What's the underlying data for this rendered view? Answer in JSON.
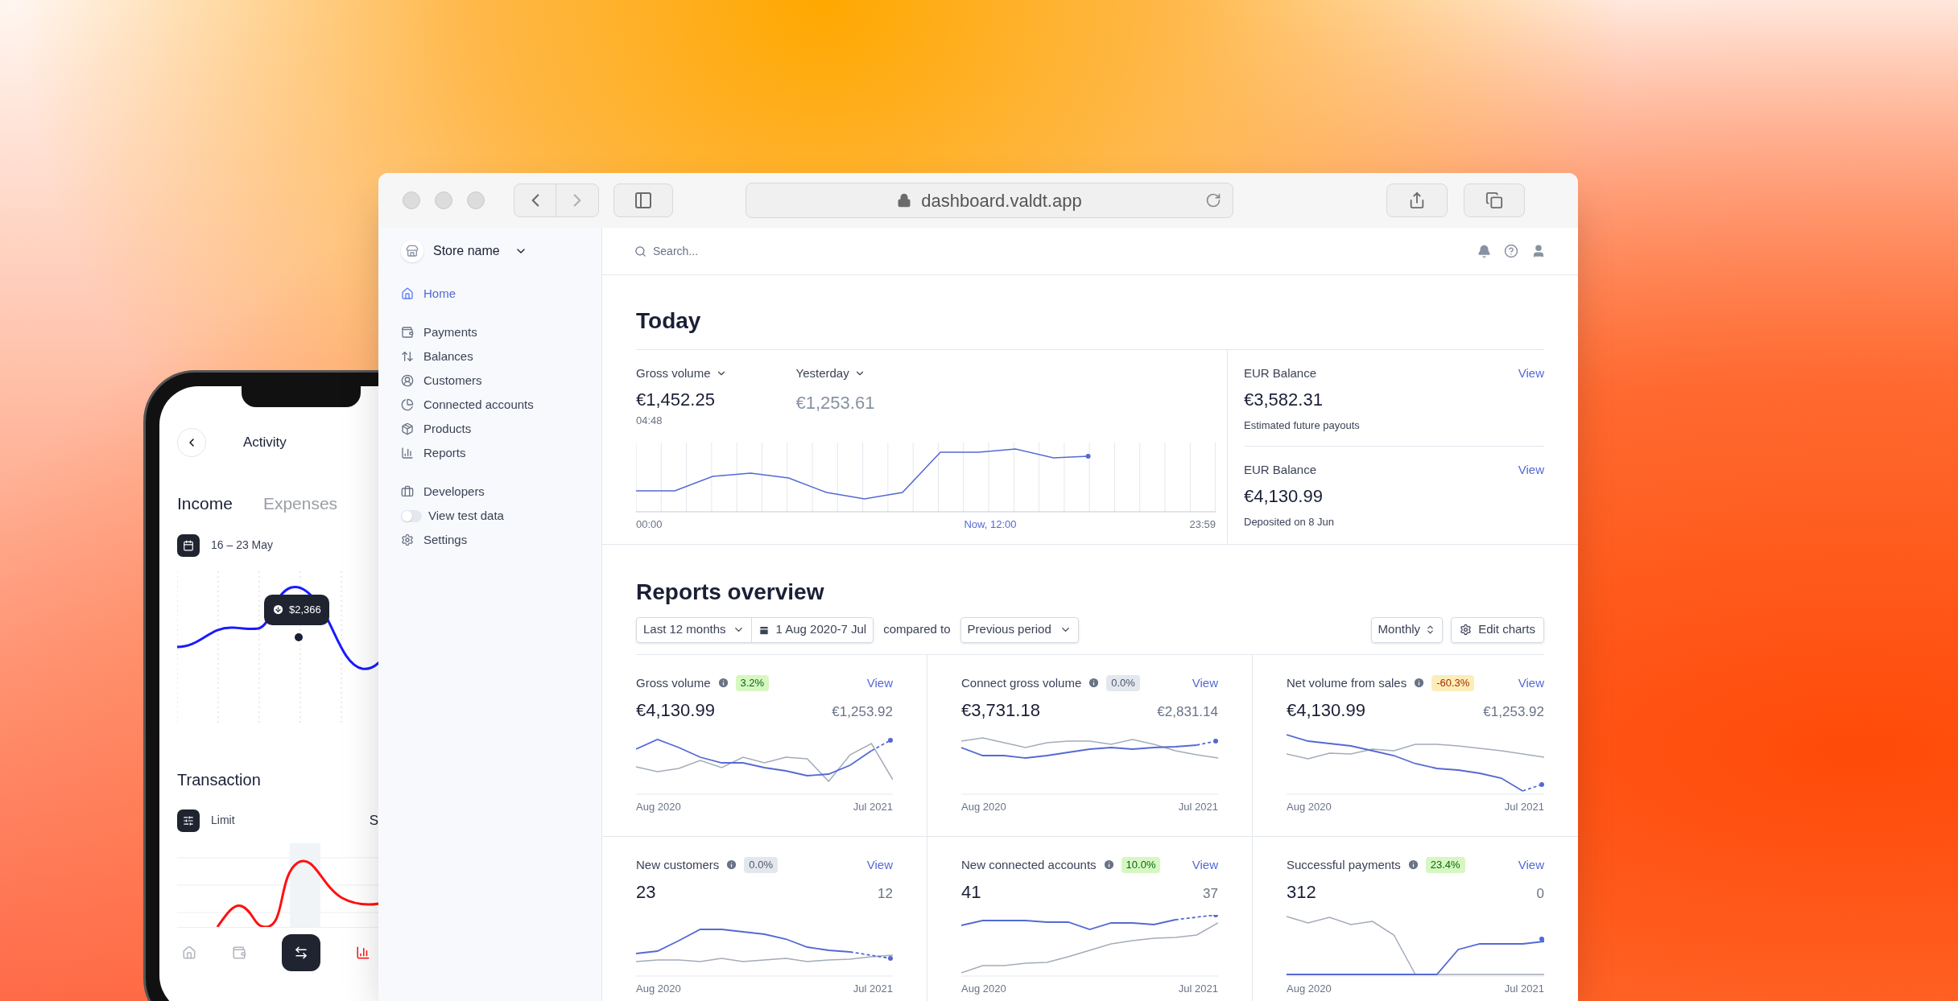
{
  "phone": {
    "title": "Activity",
    "tabs": [
      {
        "label": "Income",
        "selected": true
      },
      {
        "label": "Expenses",
        "selected": false
      }
    ],
    "date_range": "16 – 23 May",
    "tooltip": "$2,366",
    "section_title": "Transaction",
    "filter": "Limit",
    "cut_text": "S",
    "nav": [
      {
        "kind": "home",
        "selected": false
      },
      {
        "kind": "wallet",
        "selected": false
      },
      {
        "kind": "transfer",
        "selected": false
      },
      {
        "kind": "stats",
        "selected": true
      }
    ]
  },
  "browser": {
    "url": "dashboard.valdt.app"
  },
  "sidebar": {
    "store_name": "Store name",
    "groups": [
      [
        {
          "kind": "home",
          "label": "Home",
          "selected": true
        }
      ],
      [
        {
          "kind": "payments",
          "label": "Payments",
          "selected": false
        },
        {
          "kind": "balances",
          "label": "Balances",
          "selected": false
        },
        {
          "kind": "customers",
          "label": "Customers",
          "selected": false
        },
        {
          "kind": "connected",
          "label": "Connected accounts",
          "selected": false
        },
        {
          "kind": "products",
          "label": "Products",
          "selected": false
        },
        {
          "kind": "reports",
          "label": "Reports",
          "selected": false
        }
      ],
      [
        {
          "kind": "developers",
          "label": "Developers",
          "selected": false
        },
        {
          "kind": "toggle",
          "label": "View test data",
          "on": false
        },
        {
          "kind": "settings",
          "label": "Settings",
          "selected": false
        }
      ]
    ]
  },
  "search": {
    "placeholder": "Search..."
  },
  "today": {
    "title": "Today",
    "metrics": [
      {
        "label": "Gross volume",
        "value": "€1,452.25",
        "time": "04:48"
      },
      {
        "label": "Yesterday",
        "value": "€1,253.61"
      }
    ],
    "axis": [
      "00:00",
      "Now, 12:00",
      "23:59"
    ],
    "balances": [
      {
        "label": "EUR Balance",
        "link": "View",
        "value": "€3,582.31",
        "note": "Estimated future payouts"
      },
      {
        "label": "EUR Balance",
        "link": "View",
        "value": "€4,130.99",
        "note": "Deposited on 8 Jun"
      }
    ]
  },
  "reports": {
    "title": "Reports overview",
    "range": "Last 12 months",
    "dates": "1 Aug 2020-7 Jul",
    "compared_label": "compared to",
    "comparison": "Previous period",
    "interval": "Monthly",
    "edit": "Edit charts",
    "cards": [
      {
        "title": "Gross volume",
        "change": "3.2%",
        "kind": "up",
        "link": "View",
        "value": "€4,130.99",
        "previous": "€1,253.92",
        "start": "Aug 2020",
        "end": "Jul 2021"
      },
      {
        "title": "Connect gross volume",
        "change": "0.0%",
        "kind": "flat",
        "link": "View",
        "value": "€3,731.18",
        "previous": "€2,831.14",
        "start": "Aug 2020",
        "end": "Jul 2021"
      },
      {
        "title": "Net volume from sales",
        "change": "-60.3%",
        "kind": "down",
        "link": "View",
        "value": "€4,130.99",
        "previous": "€1,253.92",
        "start": "Aug 2020",
        "end": "Jul 2021"
      },
      {
        "title": "New customers",
        "change": "0.0%",
        "kind": "flat",
        "link": "View",
        "value": "23",
        "previous": "12",
        "start": "Aug 2020",
        "end": "Jul 2021"
      },
      {
        "title": "New connected accounts",
        "change": "10.0%",
        "kind": "up",
        "link": "View",
        "value": "41",
        "previous": "37",
        "start": "Aug 2020",
        "end": "Jul 2021"
      },
      {
        "title": "Successful payments",
        "change": "23.4%",
        "kind": "up",
        "link": "View",
        "value": "312",
        "previous": "0",
        "start": "Aug 2020",
        "end": "Jul 2021"
      }
    ]
  }
}
